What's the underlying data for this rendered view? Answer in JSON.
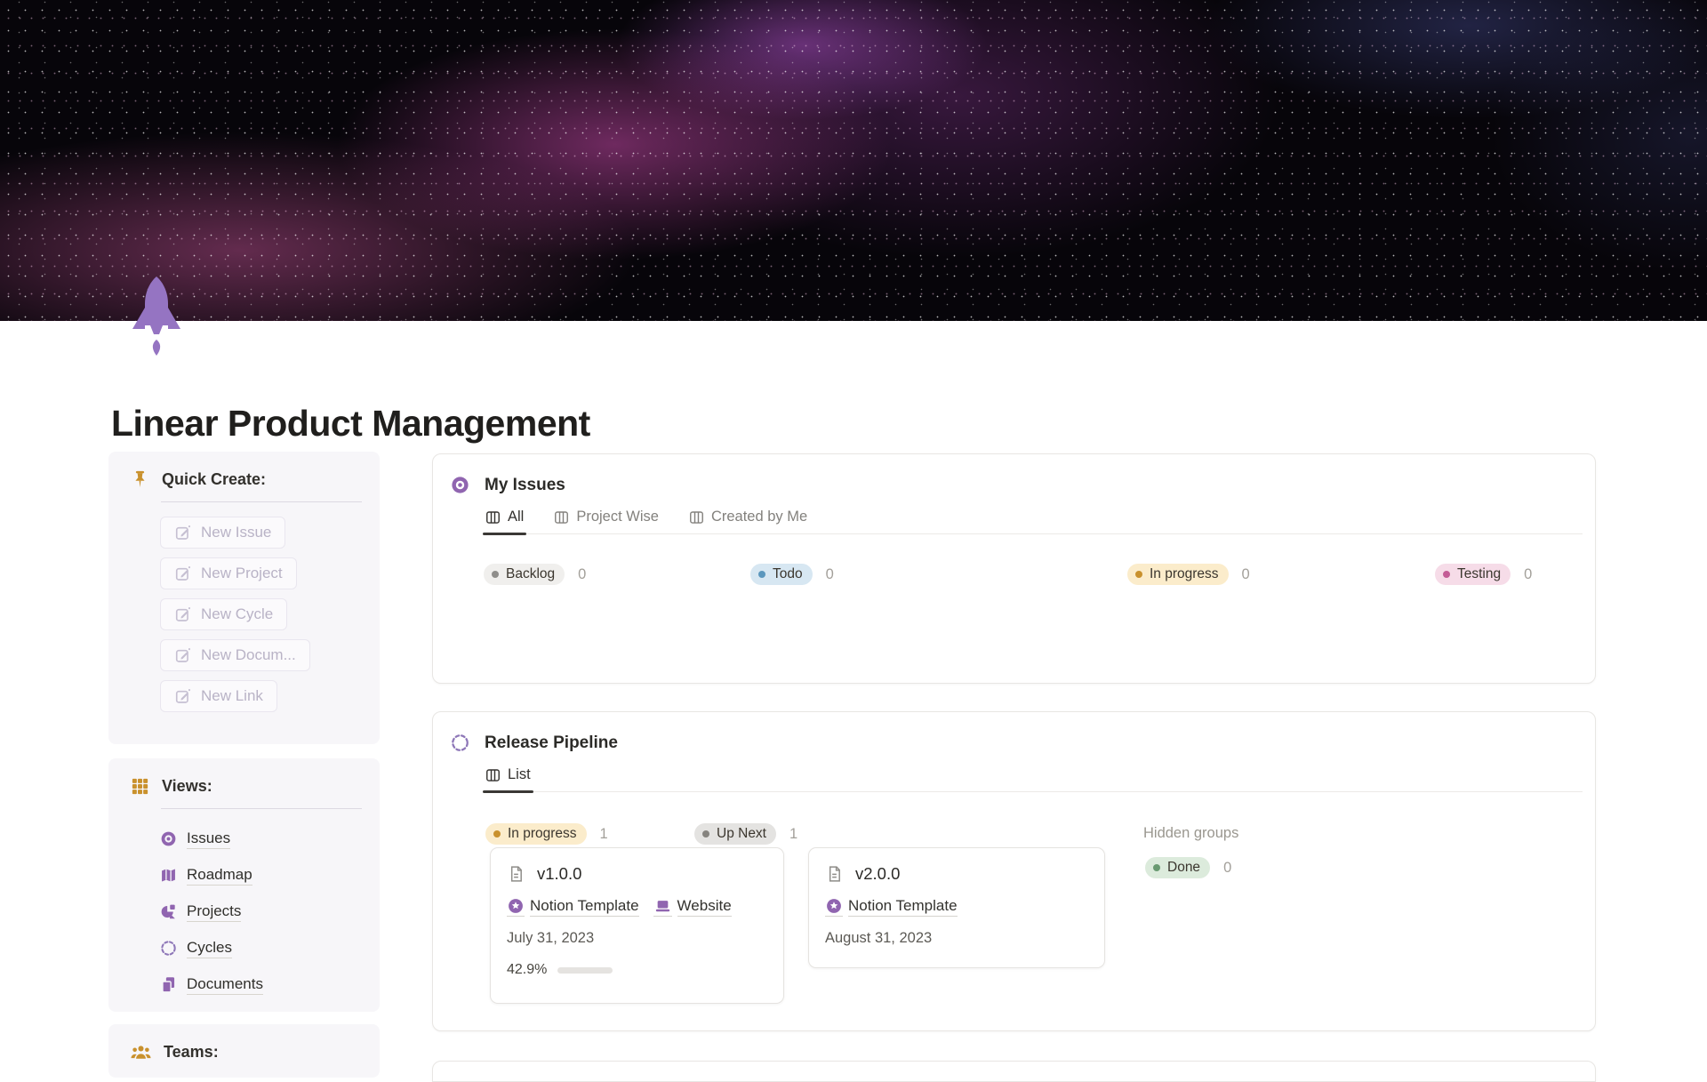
{
  "page": {
    "title": "Linear Product Management",
    "icon": "rocket-icon"
  },
  "colors": {
    "accent_purple": "#9065b0",
    "rocket_purple": "#9574c2",
    "icon_gold": "#c9912d",
    "progress_green": "#6b9080",
    "pill_gray_bg": "#f0efed",
    "pill_blue_bg": "#d7e7f2",
    "pill_yellow_bg": "#fbeccb",
    "pill_pink_bg": "#f6dce8",
    "pill_green_bg": "#dcebdc",
    "sidebar_bg": "#f7f6f9",
    "banner_bg": "#07050a"
  },
  "sidebar": {
    "quick_create": {
      "title": "Quick Create:",
      "icon": "pushpin-icon",
      "buttons": [
        "New Issue",
        "New Project",
        "New Cycle",
        "New Docum...",
        "New Link"
      ]
    },
    "views": {
      "title": "Views:",
      "icon": "grid-icon",
      "items": [
        {
          "label": "Issues",
          "icon": "issues-target-icon"
        },
        {
          "label": "Roadmap",
          "icon": "roadmap-map-icon"
        },
        {
          "label": "Projects",
          "icon": "projects-shapes-icon"
        },
        {
          "label": "Cycles",
          "icon": "cycles-dashed-circle-icon"
        },
        {
          "label": "Documents",
          "icon": "documents-pages-icon"
        }
      ]
    },
    "teams": {
      "title": "Teams:",
      "icon": "teams-people-icon"
    }
  },
  "main": {
    "my_issues": {
      "title": "My Issues",
      "icon": "issues-target-icon",
      "tabs": [
        {
          "label": "All",
          "active": true
        },
        {
          "label": "Project Wise",
          "active": false
        },
        {
          "label": "Created by Me",
          "active": false
        }
      ],
      "groups": [
        {
          "label": "Backlog",
          "count": "0",
          "color": "gray"
        },
        {
          "label": "Todo",
          "count": "0",
          "color": "blue"
        },
        {
          "label": "In progress",
          "count": "0",
          "color": "yellow"
        },
        {
          "label": "Testing",
          "count": "0",
          "color": "pink"
        }
      ]
    },
    "release_pipeline": {
      "title": "Release Pipeline",
      "icon": "cycles-dashed-circle-icon",
      "tabs": [
        {
          "label": "List",
          "active": true
        }
      ],
      "groups": [
        {
          "label": "In progress",
          "count": "1",
          "color": "yellow"
        },
        {
          "label": "Up Next",
          "count": "1",
          "color": "gray2"
        }
      ],
      "hidden_groups_label": "Hidden groups",
      "hidden_group": {
        "label": "Done",
        "count": "0",
        "color": "green"
      },
      "cards": [
        {
          "title": "v1.0.0",
          "links": [
            {
              "label": "Notion Template",
              "icon": "notion-star-icon"
            },
            {
              "label": "Website",
              "icon": "laptop-icon"
            }
          ],
          "date": "July 31, 2023",
          "progress_label": "42.9%",
          "progress_pct": 42.9
        },
        {
          "title": "v2.0.0",
          "links": [
            {
              "label": "Notion Template",
              "icon": "notion-star-icon"
            }
          ],
          "date": "August 31, 2023"
        }
      ]
    }
  }
}
